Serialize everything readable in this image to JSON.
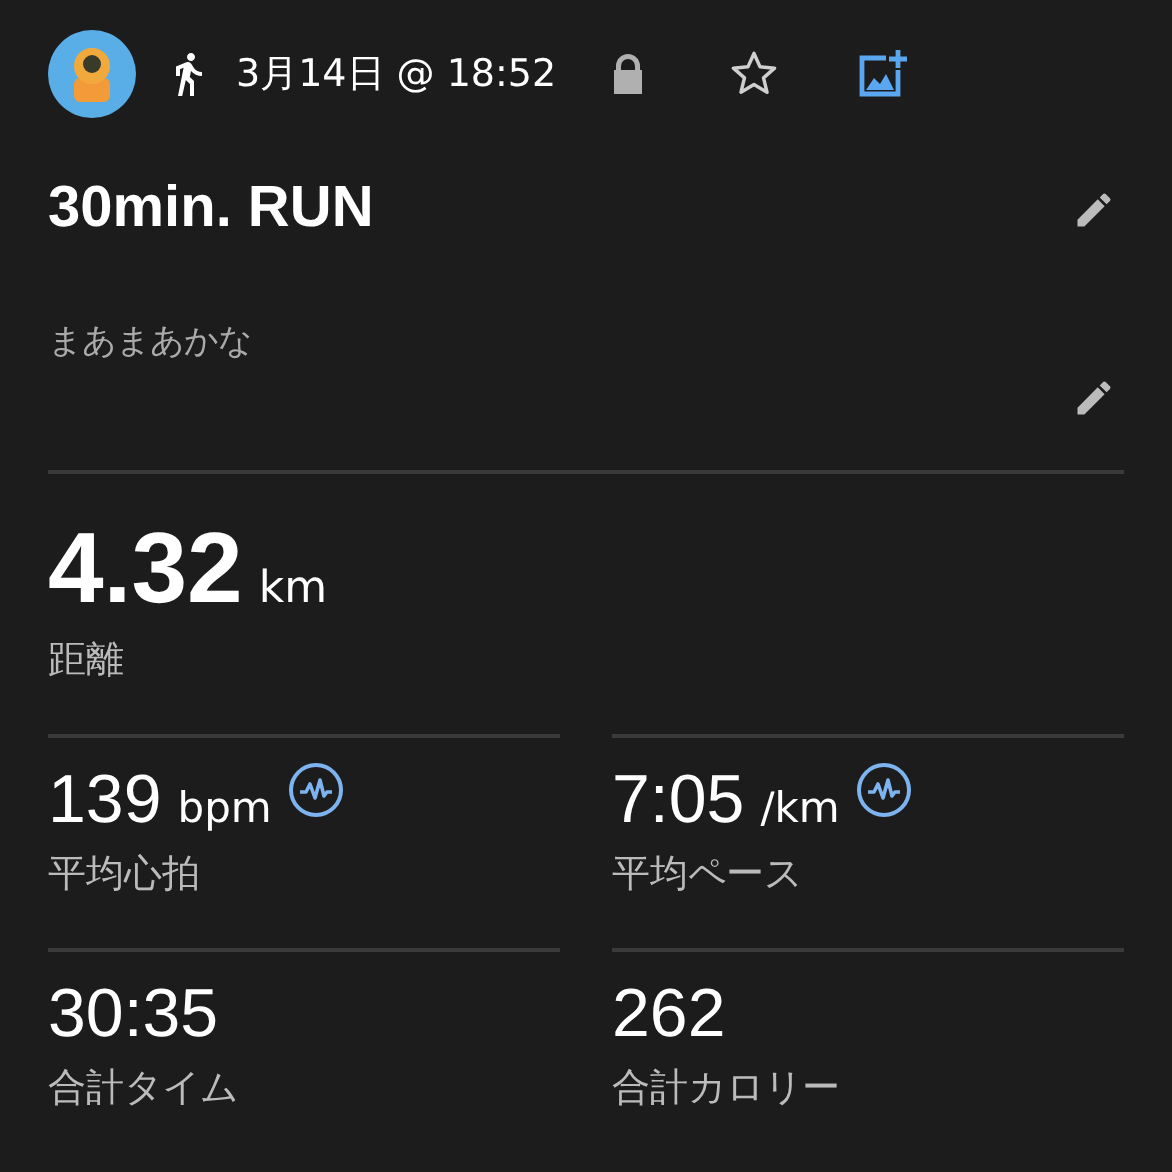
{
  "header": {
    "date": "3月14日 @ 18:52",
    "favorite": false
  },
  "title": "30min. RUN",
  "description": "まあまあかな",
  "distance": {
    "value": "4.32",
    "unit": "km",
    "label": "距離"
  },
  "stats": [
    {
      "value": "139",
      "unit": "bpm",
      "label": "平均心拍",
      "graph": true
    },
    {
      "value": "7:05",
      "unit": "/km",
      "label": "平均ペース",
      "graph": true
    },
    {
      "value": "30:35",
      "label": "合計タイム",
      "graph": false
    },
    {
      "value": "262",
      "label": "合計カロリー",
      "graph": false
    }
  ]
}
